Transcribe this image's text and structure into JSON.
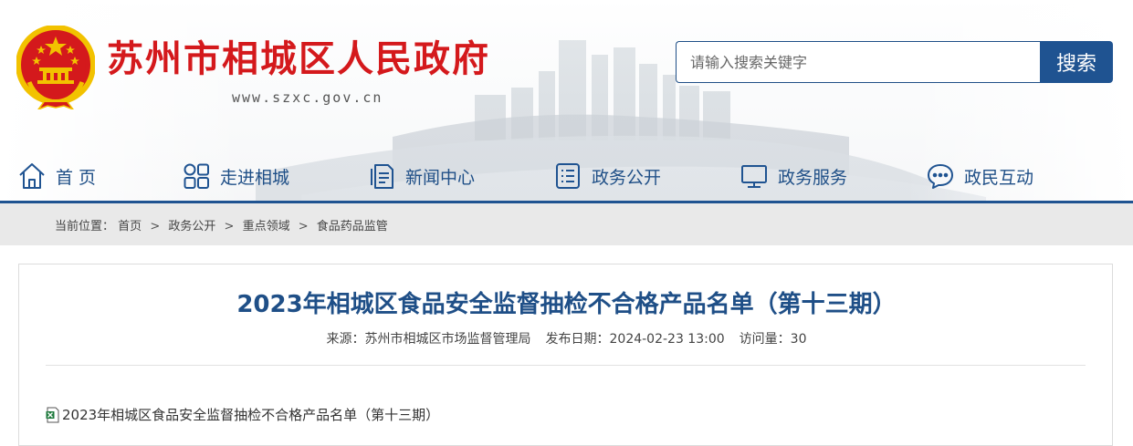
{
  "header": {
    "site_title": "苏州市相城区人民政府",
    "site_url": "www.szxc.gov.cn",
    "emblem_icon": "national-emblem-icon"
  },
  "search": {
    "placeholder": "请输入搜索关键字",
    "value": "",
    "button_label": "搜索"
  },
  "nav": {
    "items": [
      {
        "label": "首 页",
        "icon": "home-icon"
      },
      {
        "label": "走进相城",
        "icon": "grid-icon"
      },
      {
        "label": "新闻中心",
        "icon": "document-icon"
      },
      {
        "label": "政务公开",
        "icon": "list-icon"
      },
      {
        "label": "政务服务",
        "icon": "monitor-icon"
      },
      {
        "label": "政民互动",
        "icon": "chat-icon"
      }
    ]
  },
  "breadcrumb": {
    "prefix": "当前位置：",
    "items": [
      "首页",
      "政务公开",
      "重点领域",
      "食品药品监管"
    ],
    "separator": ">"
  },
  "article": {
    "title": "2023年相城区食品安全监督抽检不合格产品名单（第十三期）",
    "source_label": "来源：",
    "source": "苏州市相城区市场监督管理局",
    "date_label": "发布日期：",
    "date": "2024-02-23 13:00",
    "views_label": "访问量：",
    "views": "30",
    "attachment": {
      "label": "2023年相城区食品安全监督抽检不合格产品名单（第十三期）",
      "icon": "excel-file-icon"
    }
  },
  "colors": {
    "brand_red": "#d4191c",
    "brand_blue": "#1f5391",
    "nav_text": "#1f4f87",
    "breadcrumb_bg": "#e9e9e9"
  }
}
